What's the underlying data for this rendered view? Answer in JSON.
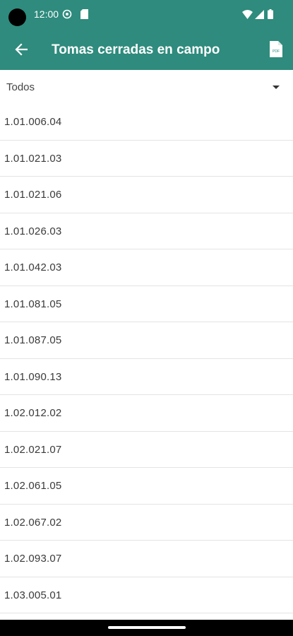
{
  "status_bar": {
    "time": "12:00"
  },
  "app_bar": {
    "title": "Tomas cerradas en campo",
    "back_icon": "arrow-back-icon",
    "pdf_icon": "pdf-file-icon",
    "pdf_icon_text": "PDF"
  },
  "filter": {
    "selected": "Todos"
  },
  "items": [
    "1.01.006.04",
    "1.01.021.03",
    "1.01.021.06",
    "1.01.026.03",
    "1.01.042.03",
    "1.01.081.05",
    "1.01.087.05",
    "1.01.090.13",
    "1.02.012.02",
    "1.02.021.07",
    "1.02.061.05",
    "1.02.067.02",
    "1.02.093.07",
    "1.03.005.01"
  ],
  "colors": {
    "app_bar": "#2e8b7d",
    "background": "#ffffff",
    "divider": "#e4e4e4"
  }
}
